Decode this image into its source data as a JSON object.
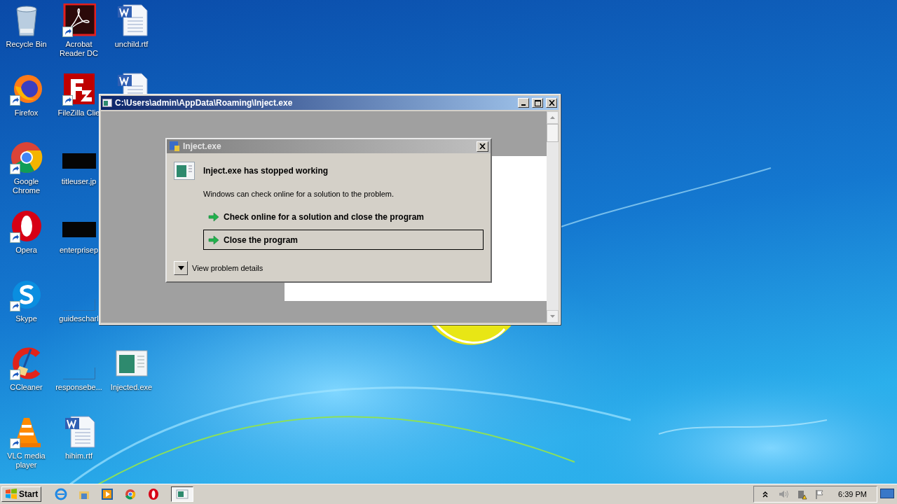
{
  "desktop": {
    "columns": [
      [
        {
          "label": "Recycle Bin",
          "kind": "recycle",
          "shortcut": false
        },
        {
          "label": "Firefox",
          "kind": "firefox",
          "shortcut": true
        },
        {
          "label": "Google Chrome",
          "kind": "chrome",
          "shortcut": true
        },
        {
          "label": "Opera",
          "kind": "opera",
          "shortcut": true
        },
        {
          "label": "Skype",
          "kind": "skype",
          "shortcut": true
        },
        {
          "label": "CCleaner",
          "kind": "ccleaner",
          "shortcut": true
        },
        {
          "label": "VLC media player",
          "kind": "vlc",
          "shortcut": true
        }
      ],
      [
        {
          "label": "Acrobat Reader DC",
          "kind": "acrobat",
          "shortcut": true
        },
        {
          "label": "FileZilla Clie",
          "kind": "filezilla",
          "shortcut": true
        },
        {
          "label": "titleuser.jp",
          "kind": "dark-thumb",
          "shortcut": false
        },
        {
          "label": "enterprisep",
          "kind": "dark-thumb",
          "shortcut": false
        },
        {
          "label": "guidescharl",
          "kind": "blank-thumb",
          "shortcut": false
        },
        {
          "label": "responsebe...",
          "kind": "blank-thumb",
          "shortcut": false
        },
        {
          "label": "hihim.rtf",
          "kind": "word",
          "shortcut": false
        }
      ],
      [
        {
          "label": "unchild.rtf",
          "kind": "word",
          "shortcut": false
        },
        {
          "kind": "word"
        },
        {
          "label": "Injected.exe",
          "kind": "exe",
          "shortcut": false
        }
      ]
    ]
  },
  "window": {
    "title": "C:\\Users\\admin\\AppData\\Roaming\\Inject.exe"
  },
  "dialog": {
    "title": "Inject.exe",
    "heading": "Inject.exe has stopped working",
    "message": "Windows can check online for a solution to the problem.",
    "options": [
      {
        "label": "Check online for a solution and close the program",
        "selected": false
      },
      {
        "label": "Close the program",
        "selected": true
      }
    ],
    "details": {
      "label": "View problem details",
      "expanded": false
    }
  },
  "taskbar": {
    "start": "Start",
    "pinned": [
      {
        "kind": "ie"
      },
      {
        "kind": "explorer"
      },
      {
        "kind": "media"
      },
      {
        "kind": "chrome"
      },
      {
        "kind": "opera"
      }
    ],
    "tasks": [
      {
        "kind": "exe",
        "selected": true
      }
    ],
    "tray": [
      {
        "kind": "chevron"
      },
      {
        "kind": "volume"
      },
      {
        "kind": "network"
      },
      {
        "kind": "flag"
      }
    ],
    "clock": "6:39 PM"
  }
}
